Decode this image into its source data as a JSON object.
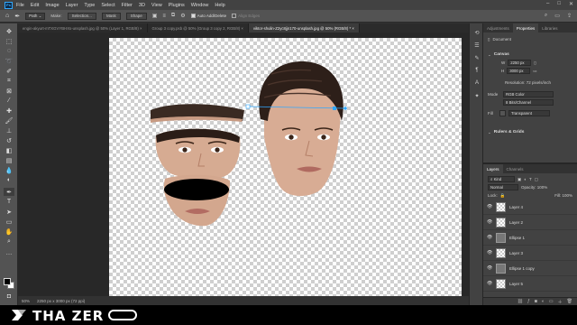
{
  "menubar": {
    "app_icon": "Ps",
    "items": [
      "File",
      "Edit",
      "Image",
      "Layer",
      "Type",
      "Select",
      "Filter",
      "3D",
      "View",
      "Plugins",
      "Window",
      "Help"
    ]
  },
  "options": {
    "tool_mode": "Path",
    "make_label": "Make:",
    "selection_btn": "Selection...",
    "mask_btn": "Mask",
    "shape_btn": "Shape",
    "auto_add_delete": "Auto Add/Delete",
    "align_edges": "Align Edges"
  },
  "tabs": [
    "engin-akyurt-mTXGVYBHXs-unsplash.jpg @ 50% (Layer 1, RGB/8)",
    "Group 3 copy.psb @ 50% (Group 3 copy 2, RGB/8)",
    "viktor-shulin-Z2yc8jjn170-unsplash.jpg @ 50% (RGB/8) *"
  ],
  "status": {
    "zoom": "50%",
    "doc_size": "2250 px x 3000 px (72 ppi)"
  },
  "properties": {
    "tabs": [
      "Adjustments",
      "Properties",
      "Libraries"
    ],
    "doc_label": "Document",
    "canvas_head": "Canvas",
    "width": "2250 px",
    "height": "3000 px",
    "resolution": "Resolution: 72 pixels/inch",
    "mode_label": "Mode",
    "mode_value": "RGB Color",
    "depth_value": "8 Bits/Channel",
    "fill_label": "Fill",
    "fill_value": "Transparent",
    "rulers_head": "Rulers & Grids"
  },
  "layers": {
    "tabs": [
      "Layers",
      "Channels"
    ],
    "kind": "Kind",
    "blend": "Normal",
    "opacity": "Opacity: 100%",
    "lock": "Lock:",
    "fill": "Fill: 100%",
    "items": [
      {
        "name": "Layer 4",
        "type": "layer",
        "selected": false
      },
      {
        "name": "Layer 2",
        "type": "layer",
        "selected": false
      },
      {
        "name": "Ellipse 1",
        "type": "ellipse",
        "selected": false
      },
      {
        "name": "Layer 3",
        "type": "layer",
        "selected": false
      },
      {
        "name": "Ellipse 1 copy",
        "type": "ellipse",
        "selected": false
      },
      {
        "name": "Layer 5",
        "type": "layer",
        "selected": false
      }
    ]
  },
  "brand": {
    "text": "THA ZER"
  },
  "colors": {
    "accent": "#31a8ff",
    "panel": "#424242",
    "canvas_bg": "#282828"
  }
}
